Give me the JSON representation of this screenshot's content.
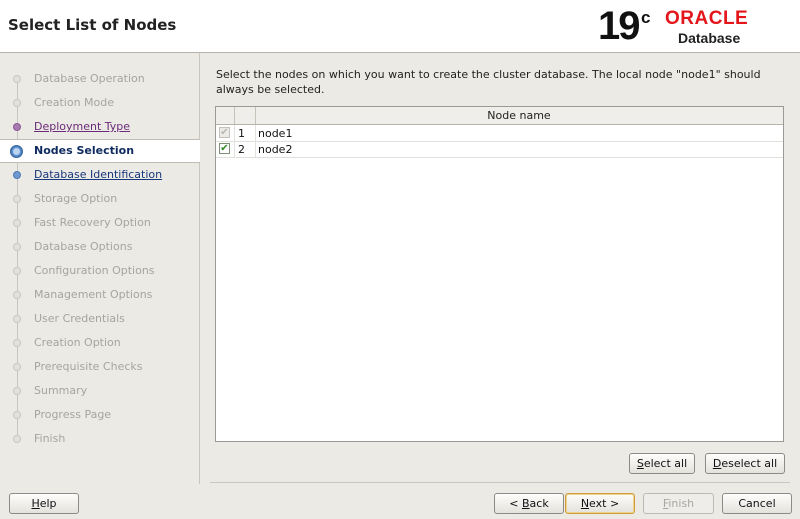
{
  "header": {
    "title": "Select List of Nodes",
    "logo": {
      "version_number": "19",
      "version_suffix": "c",
      "brand": "ORACLE",
      "product": "Database"
    }
  },
  "sidebar": {
    "steps": [
      {
        "label": "Database Operation",
        "state": "disabled"
      },
      {
        "label": "Creation Mode",
        "state": "disabled"
      },
      {
        "label": "Deployment Type",
        "state": "visited"
      },
      {
        "label": "Nodes Selection",
        "state": "current"
      },
      {
        "label": "Database Identification",
        "state": "next"
      },
      {
        "label": "Storage Option",
        "state": "disabled"
      },
      {
        "label": "Fast Recovery Option",
        "state": "disabled"
      },
      {
        "label": "Database Options",
        "state": "disabled"
      },
      {
        "label": "Configuration Options",
        "state": "disabled"
      },
      {
        "label": "Management Options",
        "state": "disabled"
      },
      {
        "label": "User Credentials",
        "state": "disabled"
      },
      {
        "label": "Creation Option",
        "state": "disabled"
      },
      {
        "label": "Prerequisite Checks",
        "state": "disabled"
      },
      {
        "label": "Summary",
        "state": "disabled"
      },
      {
        "label": "Progress Page",
        "state": "disabled"
      },
      {
        "label": "Finish",
        "state": "disabled"
      }
    ]
  },
  "main": {
    "description": "Select the nodes on which you want to create the cluster database. The local node \"node1\" should always be selected.",
    "table": {
      "column_header": "Node name",
      "rows": [
        {
          "index": "1",
          "name": "node1",
          "checked": true,
          "disabled": true
        },
        {
          "index": "2",
          "name": "node2",
          "checked": true,
          "disabled": false
        }
      ]
    },
    "select_all": "Select all",
    "deselect_all": "Deselect all"
  },
  "footer": {
    "help": "Help",
    "back": "< Back",
    "next": "Next >",
    "finish": "Finish",
    "cancel": "Cancel"
  },
  "colors": {
    "brand_red": "#e3161b",
    "current_step_text": "#0e2a5e",
    "visited_step": "#6b2a7a",
    "next_step": "#17387c",
    "check_green": "#2f8a22"
  }
}
